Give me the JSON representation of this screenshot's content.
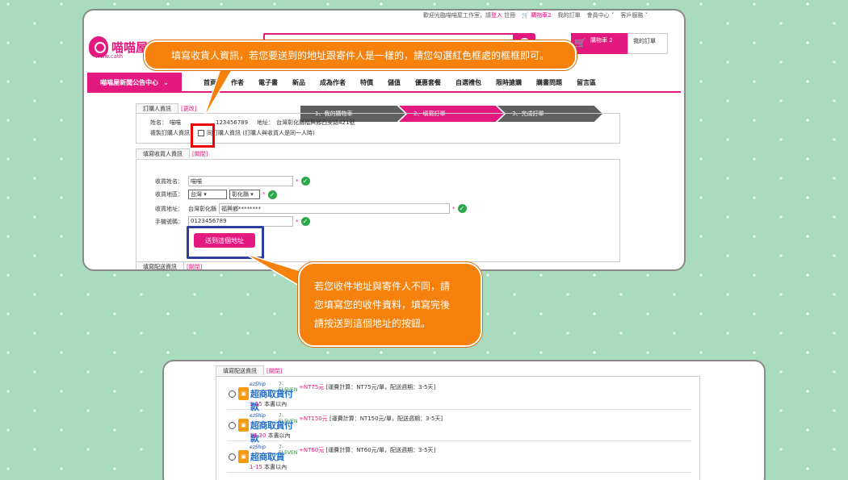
{
  "topbar": {
    "welcome": "歡迎光臨喵喵屋工作室，請",
    "login": "登入",
    "register": "註冊",
    "cart": "購物車2",
    "my_orders": "我的訂單",
    "member": "會員中心",
    "service": "客戶服務"
  },
  "header": {
    "logo_text": "喵喵屋",
    "logo_sub": "www.cath",
    "cart_label": "購物車 2",
    "my_order_label": "我的訂單"
  },
  "nav": {
    "announce": "喵喵屋新聞公告中心",
    "items": [
      "首頁",
      "作者",
      "電子書",
      "新品",
      "成為作者",
      "特價",
      "儲值",
      "優惠套餐",
      "自選禮包",
      "限時搶購",
      "購書問題",
      "留言區"
    ]
  },
  "steps": [
    "1、我的購物車",
    "2、填寫訂單",
    "3、完成訂單"
  ],
  "buyer": {
    "tab": "訂購人資訊",
    "tab_edit": "[更改]",
    "name_label": "姓名：",
    "name": "喵喵",
    "phone": "123456789",
    "address_label": "地址：",
    "address": "台灣彰化縣福興鄉西安路421號",
    "copy_label": "複製訂購人資訊：",
    "copy_text": "同訂購人資訊 (訂購人與收貨人是同一人時)"
  },
  "receiver": {
    "tab": "填寫收貨人資訊",
    "tab_toggle": "[關閉]",
    "name_label": "收貨姓名：",
    "name_value": "喵喵",
    "region_label": "收貨地區：",
    "region_country": "台灣",
    "region_county": "彰化縣",
    "address_label": "收貨地址：",
    "address_prefix": "台灣彰化縣",
    "address_value": "福興鄉********",
    "phone_label": "手機號碼：",
    "phone_value": "0123456789",
    "required_mark": "*",
    "send_button": "送到這個地址"
  },
  "shipping": {
    "tab": "填寫配送資訊",
    "tab_toggle": "[關閉]"
  },
  "callouts": {
    "top": "填寫收貨人資訊，若您要送到的地址跟寄件人是一樣的，請您勾選紅色框處的框框即可。",
    "bottom_lines": [
      "若您收件地址與寄件人不同，請",
      "您填寫您的收件資料，填寫完後",
      "請按送到這個地址的按鈕。"
    ]
  },
  "shipping_options": [
    {
      "brand": "ezShip",
      "brand2": "7-ELEVEN",
      "title": "超商取貨付款",
      "qty_range": "1-15",
      "qty_unit": "本書以內",
      "price": "+NT75元",
      "detail": "[運費計算：NT75元/單，配送週期：3-5天]"
    },
    {
      "brand": "ezShip",
      "brand2": "7-ELEVEN",
      "title": "超商取貨付款",
      "qty_range": "16-30",
      "qty_unit": "本書以內",
      "price": "+NT150元",
      "detail": "[運費計算：NT150元/單，配送週期：3-5天]"
    },
    {
      "brand": "ezShip",
      "brand2": "7-ELEVEN",
      "title": "超商取貨",
      "qty_range": "1-15",
      "qty_unit": "本書以內",
      "price": "+NT60元",
      "detail": "[運費計算：NT60元/單，配送週期：3-5天]"
    }
  ],
  "colors": {
    "accent": "#e4197f",
    "callout": "#f6820d",
    "background": "#a9dcbf",
    "highlight_red": "#e00000",
    "highlight_blue": "#2c3e9f"
  }
}
